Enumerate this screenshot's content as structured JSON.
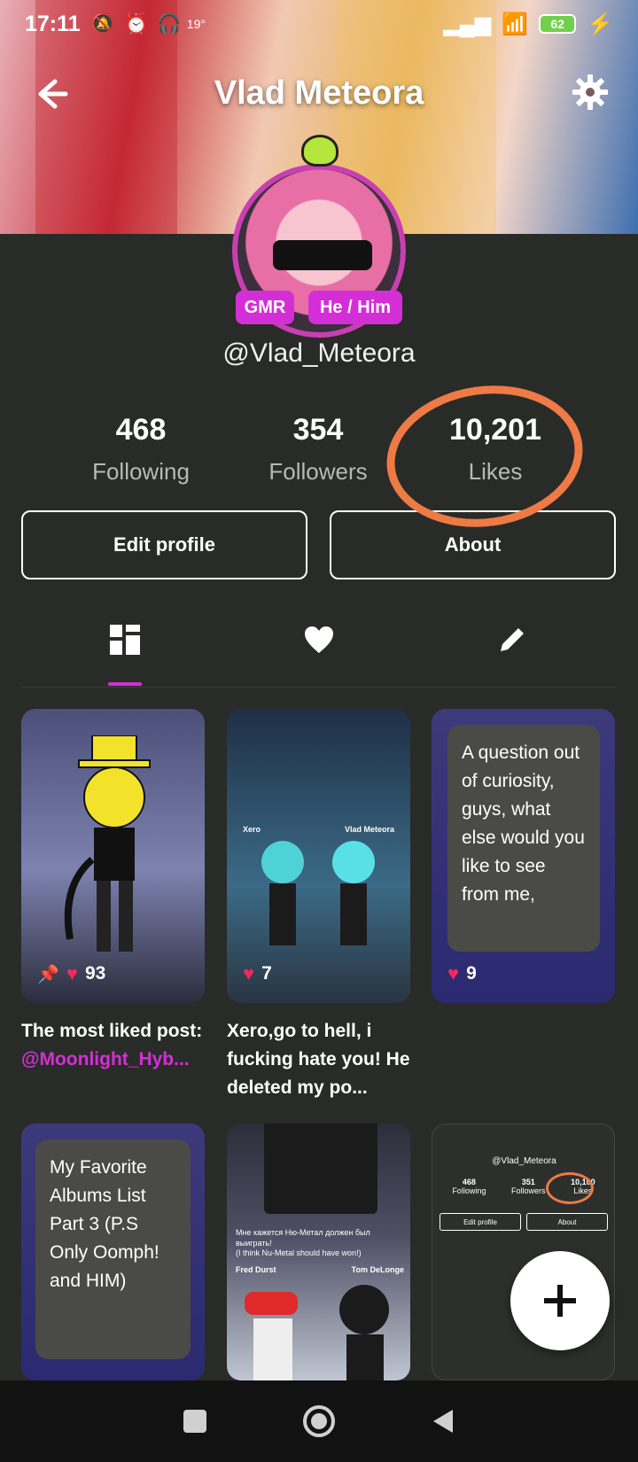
{
  "status_bar": {
    "time": "17:11",
    "temperature": "19°",
    "battery": "62"
  },
  "header": {
    "title": "Vlad Meteora"
  },
  "profile": {
    "badges": [
      "GMR",
      "He / Him"
    ],
    "username": "@Vlad_Meteora",
    "stats": [
      {
        "value": "468",
        "label": "Following"
      },
      {
        "value": "354",
        "label": "Followers"
      },
      {
        "value": "10,201",
        "label": "Likes"
      }
    ],
    "buttons": {
      "edit": "Edit profile",
      "about": "About"
    }
  },
  "tabs": [
    "posts-grid",
    "liked",
    "drafts"
  ],
  "posts": [
    {
      "likes": "93",
      "pinned": true,
      "caption": "The most liked post:",
      "mention": "@Moonlight_Hyb..."
    },
    {
      "likes": "7",
      "caption": "Xero,go to hell, i fucking hate you! He deleted my po...",
      "character_names": [
        "Xero",
        "Vlad Meteora"
      ]
    },
    {
      "likes": "9",
      "text": "A question out of curiosity, guys, what else would you like to see from me,"
    },
    {
      "text": "My Favorite Albums List Part 3 (P.S Only Oomph! and HIM)"
    },
    {
      "caption_ru": "Мне кажется Ню-Метал должен был выиграть!",
      "caption_en": "(I think Nu-Metal should have won!)",
      "names": [
        "Fred Durst",
        "Tom DeLonge"
      ]
    },
    {
      "mini_username": "@Vlad_Meteora",
      "mini_stats": [
        {
          "value": "468",
          "label": "Following"
        },
        {
          "value": "351",
          "label": "Followers"
        },
        {
          "value": "10,100",
          "label": "Likes"
        }
      ],
      "mini_buttons": [
        "Edit profile",
        "About"
      ]
    }
  ],
  "colors": {
    "background": "#292b28",
    "accent": "#d42fd6",
    "heart": "#f0285e",
    "annotation": "#ee7a45"
  }
}
